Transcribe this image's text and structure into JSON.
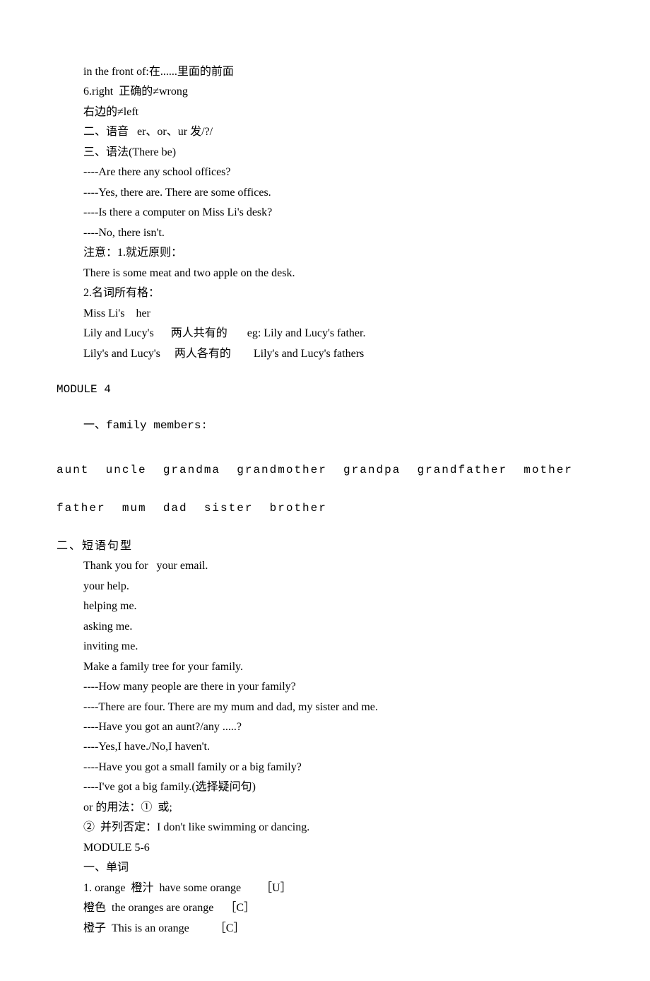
{
  "lines": {
    "l1": "in the front of:在......里面的前面",
    "l2": "6.right  正确的≠wrong",
    "l3": "右边的≠left",
    "l4": "二、语音   er、or、ur 发/?/",
    "l5": "三、语法(There be)",
    "l6": "----Are there any school offices?",
    "l7": "----Yes, there are. There are some offices.",
    "l8": "----Is there a computer on Miss Li's desk?",
    "l9": "----No, there isn't.",
    "l10": "注意：1.就近原则：",
    "l11": "There is some meat and two apple on the desk.",
    "l12": "2.名词所有格：",
    "l13": "Miss Li's    her",
    "l14": "Lily and Lucy's      两人共有的       eg: Lily and Lucy's father.",
    "l15": "Lily's and Lucy's     两人各有的        Lily's and Lucy's fathers"
  },
  "module4": {
    "heading": "MODULE 4",
    "sub": "一、family members:",
    "members": "aunt  uncle  grandma  grandmother  grandpa  grandfather  mother  father  mum  dad  sister  brother"
  },
  "section2": {
    "heading": "二、短语句型",
    "l1": "Thank you for   your email.",
    "l2": "your help.",
    "l3": "helping me.",
    "l4": "asking me.",
    "l5": "inviting me.",
    "l6": "Make a family tree for your family.",
    "l7": "----How many people are there in your family?",
    "l8": "----There are four. There are my mum and dad, my sister and me.",
    "l9": "----Have you got an aunt?/any .....?",
    "l10": "----Yes,I have./No,I haven't.",
    "l11": "----Have you got a small family or a big family?",
    "l12": "----I've got a big family.(选择疑问句)",
    "l13": "or 的用法：①  或;",
    "l14": "②  并列否定：I don't like swimming or dancing.",
    "l15": "MODULE 5-6",
    "l16": "一、单词",
    "l17": "1. orange  橙汁  have some orange       ［U］",
    "l18": "橙色  the oranges are orange    ［C］",
    "l19": "橙子  This is an orange         ［C］"
  }
}
